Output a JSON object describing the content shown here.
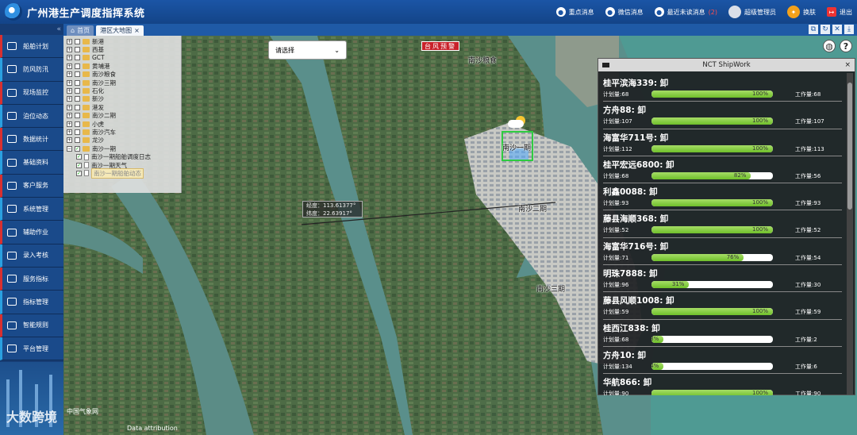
{
  "header": {
    "title": "广州港生产调度指挥系统",
    "items": [
      {
        "label": "重点消息"
      },
      {
        "label": "微信消息"
      },
      {
        "label": "最近未读消息",
        "count": "(2)"
      },
      {
        "label": "超级管理员"
      },
      {
        "label": "换肤"
      },
      {
        "label": "退出"
      }
    ]
  },
  "sidebar": {
    "collapse_glyph": "«",
    "items": [
      {
        "label": "船舶计划"
      },
      {
        "label": "防风防汛"
      },
      {
        "label": "现场监控"
      },
      {
        "label": "泊位动态"
      },
      {
        "label": "数据统计"
      },
      {
        "label": "基础资料"
      },
      {
        "label": "客户服务"
      },
      {
        "label": "系统管理"
      },
      {
        "label": "辅助作业"
      },
      {
        "label": "录入考核"
      },
      {
        "label": "服务指标"
      },
      {
        "label": "指标管理"
      },
      {
        "label": "智能规则"
      },
      {
        "label": "平台管理"
      }
    ]
  },
  "tabs": [
    {
      "label": "首页",
      "active": false
    },
    {
      "label": "港区大地图",
      "close": "×",
      "active": true
    }
  ],
  "tab_tools": [
    "⧉",
    "↻",
    "✕",
    "⤓"
  ],
  "tree": [
    {
      "label": "新港",
      "level": 0,
      "toggle": "+"
    },
    {
      "label": "西基",
      "level": 0,
      "toggle": "+"
    },
    {
      "label": "GCT",
      "level": 0,
      "toggle": "+"
    },
    {
      "label": "黄埔港",
      "level": 0,
      "toggle": "+"
    },
    {
      "label": "南沙粮食",
      "level": 0,
      "toggle": "+"
    },
    {
      "label": "南沙三期",
      "level": 0,
      "toggle": "+"
    },
    {
      "label": "石化",
      "level": 0,
      "toggle": "+"
    },
    {
      "label": "新沙",
      "level": 0,
      "toggle": "+"
    },
    {
      "label": "港发",
      "level": 0,
      "toggle": "+"
    },
    {
      "label": "南沙二期",
      "level": 0,
      "toggle": "+"
    },
    {
      "label": "小虎",
      "level": 0,
      "toggle": "+"
    },
    {
      "label": "南沙汽车",
      "level": 0,
      "toggle": "+"
    },
    {
      "label": "龙沙",
      "level": 0,
      "toggle": "+"
    },
    {
      "label": "南沙一期",
      "level": 0,
      "toggle": "−",
      "checked": true
    },
    {
      "label": "南沙一期船舶调度日志",
      "level": 1,
      "checked": true
    },
    {
      "label": "南沙一期天气",
      "level": 1,
      "checked": true
    },
    {
      "label": "南沙一期船舶动态",
      "level": 1,
      "checked": true,
      "selected": true
    }
  ],
  "select": {
    "value": "请选择"
  },
  "typhoon_badge": "台风预警",
  "map_labels": {
    "nansha_granary": "南沙粮食",
    "nansha_phase1": "南沙一期",
    "nansha_phase2": "南沙二期",
    "nansha_phase3": "南沙三期"
  },
  "coord": {
    "lon_label": "经度：",
    "lon": "113.61377°",
    "lat_label": "纬度：",
    "lat": "22.63917°"
  },
  "watermark": {
    "brand": "大数跨境",
    "provider": "中国气象网",
    "attribution": "Data attribution"
  },
  "ship_panel": {
    "title": "NCT ShipWork",
    "close": "×",
    "plan_label": "计划量:",
    "work_label": "工作量:",
    "ships": [
      {
        "name": "桂平滨海339: 卸",
        "plan": "68",
        "progress": 100,
        "progress_label": "100%",
        "work": "68"
      },
      {
        "name": "方舟88: 卸",
        "plan": "107",
        "progress": 100,
        "progress_label": "100%",
        "work": "107"
      },
      {
        "name": "海富华711号: 卸",
        "plan": "112",
        "progress": 100,
        "progress_label": "100%",
        "work": "113"
      },
      {
        "name": "桂平宏远6800: 卸",
        "plan": "68",
        "progress": 82,
        "progress_label": "82%",
        "work": "56"
      },
      {
        "name": "利鑫0088: 卸",
        "plan": "93",
        "progress": 100,
        "progress_label": "100%",
        "work": "93"
      },
      {
        "name": "藤县海顺368: 卸",
        "plan": "52",
        "progress": 100,
        "progress_label": "100%",
        "work": "52"
      },
      {
        "name": "海富华716号: 卸",
        "plan": "71",
        "progress": 76,
        "progress_label": "76%",
        "work": "54"
      },
      {
        "name": "明珠7888: 卸",
        "plan": "96",
        "progress": 31,
        "progress_label": "31%",
        "work": "30"
      },
      {
        "name": "藤县风顺1008: 卸",
        "plan": "59",
        "progress": 100,
        "progress_label": "100%",
        "work": "59"
      },
      {
        "name": "桂西江838: 卸",
        "plan": "68",
        "progress": 3,
        "progress_label": "3%",
        "work": "2"
      },
      {
        "name": "方舟10: 卸",
        "plan": "134",
        "progress": 4,
        "progress_label": "4%",
        "work": "6"
      },
      {
        "name": "华航866: 卸",
        "plan": "90",
        "progress": 100,
        "progress_label": "100%",
        "work": "90"
      }
    ]
  },
  "colors": {
    "header": "#1b55a6",
    "sidebar": "#163c74",
    "accent_red": "#d83030",
    "progress": "#7cc63a"
  }
}
